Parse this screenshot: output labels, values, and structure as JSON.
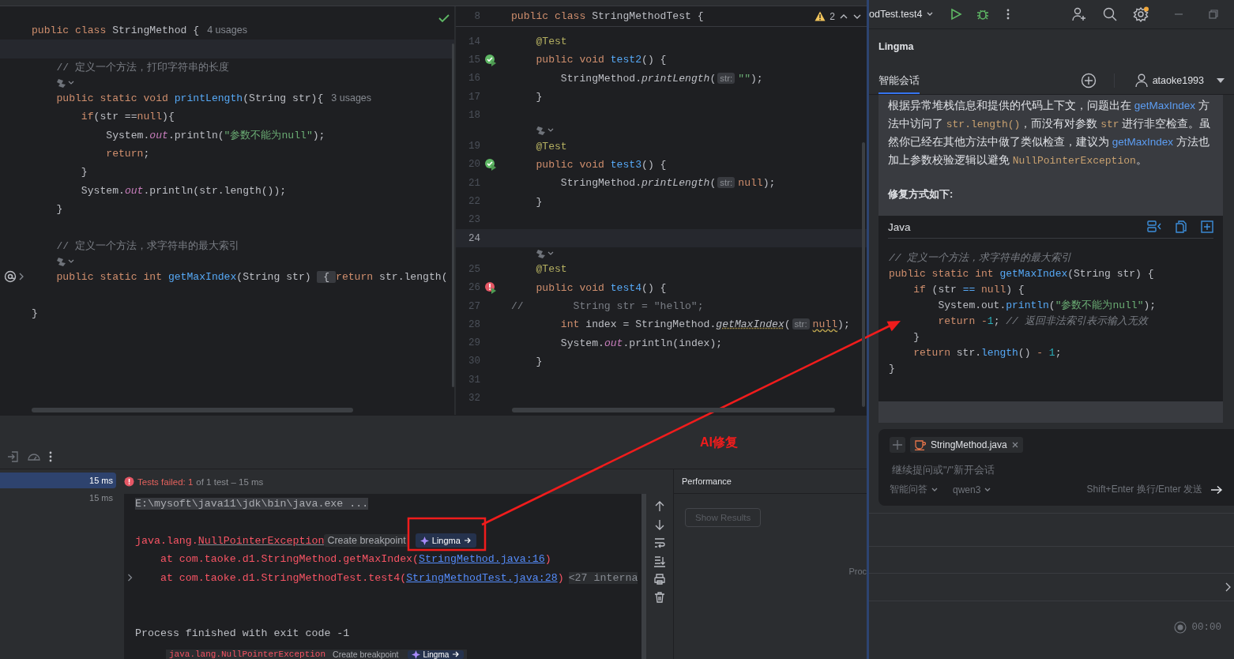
{
  "editors": [
    {
      "lines": [
        {
          "kind": "code",
          "current": false,
          "tokens": [
            {
              "kind": "keyword",
              "text": "public class "
            },
            {
              "kind": "plain",
              "text": "StringMethod {"
            },
            {
              "kind": "usages",
              "text": "4 usages"
            }
          ]
        },
        {
          "kind": "code",
          "current": true
        },
        {
          "kind": "code",
          "current": false,
          "tokens": [
            {
              "kind": "comment",
              "text": "    // 定义一个方法，打印字符串的长度"
            }
          ]
        },
        {
          "kind": "lens"
        },
        {
          "kind": "code",
          "current": false,
          "tokens": [
            {
              "kind": "keyword",
              "text": "    public static void "
            },
            {
              "kind": "method",
              "text": "printLength"
            },
            {
              "kind": "plain",
              "text": "(String str){"
            },
            {
              "kind": "usages",
              "text": "3 usages"
            }
          ]
        },
        {
          "kind": "code",
          "current": false,
          "tokens": [
            {
              "kind": "keyword",
              "text": "        if"
            },
            {
              "kind": "plain",
              "text": "(str =="
            },
            {
              "kind": "keyword",
              "text": "null"
            },
            {
              "kind": "plain",
              "text": "){"
            }
          ]
        },
        {
          "kind": "code",
          "current": false,
          "tokens": [
            {
              "kind": "plain",
              "text": "            System."
            },
            {
              "kind": "field",
              "text": "out"
            },
            {
              "kind": "plain",
              "text": ".println("
            },
            {
              "kind": "string",
              "text": "\"参数不能为null\""
            },
            {
              "kind": "plain",
              "text": ");"
            }
          ]
        },
        {
          "kind": "code",
          "current": false,
          "tokens": [
            {
              "kind": "keyword",
              "text": "            return"
            },
            {
              "kind": "plain",
              "text": ";"
            }
          ]
        },
        {
          "kind": "code",
          "current": false,
          "tokens": [
            {
              "kind": "plain",
              "text": "        }"
            }
          ]
        },
        {
          "kind": "code",
          "current": false,
          "tokens": [
            {
              "kind": "plain",
              "text": "        System."
            },
            {
              "kind": "field",
              "text": "out"
            },
            {
              "kind": "plain",
              "text": ".println(str.length());"
            }
          ]
        },
        {
          "kind": "code",
          "current": false,
          "tokens": [
            {
              "kind": "plain",
              "text": "    }"
            }
          ]
        },
        {
          "kind": "code",
          "current": false
        },
        {
          "kind": "code",
          "current": false,
          "tokens": [
            {
              "kind": "comment",
              "text": "    // 定义一个方法，求字符串的最大索引"
            }
          ]
        },
        {
          "kind": "lens"
        },
        {
          "kind": "code",
          "current": false,
          "gutter_icon": {
            "kind": "implements"
          },
          "tokens": [
            {
              "kind": "keyword",
              "text": "    public static int "
            },
            {
              "kind": "method",
              "text": "getMaxIndex"
            },
            {
              "kind": "plain",
              "text": "(String str) "
            },
            {
              "kind": "fold",
              "text": " { "
            },
            {
              "kind": "keyword",
              "text": "return"
            },
            {
              "kind": "plain",
              "text": " str.length("
            }
          ]
        },
        {
          "kind": "code",
          "current": false
        },
        {
          "kind": "code",
          "current": false,
          "tokens": [
            {
              "kind": "plain",
              "text": "}"
            }
          ]
        }
      ]
    },
    {
      "sticky_header": {
        "number": "8",
        "tokens": [
          {
            "kind": "keyword",
            "text": "public class "
          },
          {
            "kind": "plain",
            "text": "StringMethodTest {"
          }
        ]
      },
      "problems": {
        "warnings": "2"
      },
      "lines": [
        {
          "kind": "code",
          "number": "14",
          "current": false,
          "tokens": [
            {
              "kind": "annotation",
              "text": "    @Test"
            }
          ]
        },
        {
          "kind": "code",
          "number": "15",
          "current": false,
          "gutter_icon": {
            "kind": "pass"
          },
          "tokens": [
            {
              "kind": "keyword",
              "text": "    public void "
            },
            {
              "kind": "method",
              "text": "test2"
            },
            {
              "kind": "plain",
              "text": "() {"
            }
          ]
        },
        {
          "kind": "code",
          "number": "16",
          "current": false,
          "tokens": [
            {
              "kind": "plain",
              "text": "        StringMethod."
            },
            {
              "kind": "call",
              "text": "printLength"
            },
            {
              "kind": "plain",
              "text": "("
            },
            {
              "kind": "hint",
              "text": "str:"
            },
            {
              "kind": "string",
              "text": "\"\""
            },
            {
              "kind": "plain",
              "text": ");"
            }
          ]
        },
        {
          "kind": "code",
          "number": "17",
          "current": false,
          "tokens": [
            {
              "kind": "plain",
              "text": "    }"
            }
          ]
        },
        {
          "kind": "code",
          "number": "18",
          "current": false
        },
        {
          "kind": "lens"
        },
        {
          "kind": "code",
          "number": "19",
          "current": false,
          "tokens": [
            {
              "kind": "annotation",
              "text": "    @Test"
            }
          ]
        },
        {
          "kind": "code",
          "number": "20",
          "current": false,
          "gutter_icon": {
            "kind": "pass"
          },
          "tokens": [
            {
              "kind": "keyword",
              "text": "    public void "
            },
            {
              "kind": "method",
              "text": "test3"
            },
            {
              "kind": "plain",
              "text": "() {"
            }
          ]
        },
        {
          "kind": "code",
          "number": "21",
          "current": false,
          "tokens": [
            {
              "kind": "plain",
              "text": "        StringMethod."
            },
            {
              "kind": "call",
              "text": "printLength"
            },
            {
              "kind": "plain",
              "text": "("
            },
            {
              "kind": "hint",
              "text": "str:"
            },
            {
              "kind": "keyword",
              "text": "null"
            },
            {
              "kind": "plain",
              "text": ");"
            }
          ]
        },
        {
          "kind": "code",
          "number": "22",
          "current": false,
          "tokens": [
            {
              "kind": "plain",
              "text": "    }"
            }
          ]
        },
        {
          "kind": "code",
          "number": "23",
          "current": false
        },
        {
          "kind": "code",
          "number": "24",
          "current": true
        },
        {
          "kind": "lens"
        },
        {
          "kind": "code",
          "number": "25",
          "current": false,
          "tokens": [
            {
              "kind": "annotation",
              "text": "    @Test"
            }
          ]
        },
        {
          "kind": "code",
          "number": "26",
          "current": false,
          "gutter_icon": {
            "kind": "fail"
          },
          "tokens": [
            {
              "kind": "keyword",
              "text": "    public void "
            },
            {
              "kind": "method",
              "text": "test4"
            },
            {
              "kind": "plain",
              "text": "() {"
            }
          ]
        },
        {
          "kind": "code",
          "number": "27",
          "current": false,
          "tokens": [
            {
              "kind": "comment",
              "text": "//        String str = \"hello\";"
            }
          ]
        },
        {
          "kind": "code",
          "number": "28",
          "current": false,
          "tokens": [
            {
              "kind": "keyword",
              "text": "        int"
            },
            {
              "kind": "plain",
              "text": " index = StringMethod."
            },
            {
              "kind": "warn-call",
              "text": "getMaxIndex"
            },
            {
              "kind": "plain",
              "text": "("
            },
            {
              "kind": "hint",
              "text": "str:"
            },
            {
              "kind": "warn-keyword",
              "text": "null"
            },
            {
              "kind": "plain",
              "text": ");"
            }
          ]
        },
        {
          "kind": "code",
          "number": "29",
          "current": false,
          "tokens": [
            {
              "kind": "plain",
              "text": "        System."
            },
            {
              "kind": "field",
              "text": "out"
            },
            {
              "kind": "plain",
              "text": ".println(index);"
            }
          ]
        },
        {
          "kind": "code",
          "number": "30",
          "current": false,
          "tokens": [
            {
              "kind": "plain",
              "text": "    }"
            }
          ]
        },
        {
          "kind": "code",
          "number": "31",
          "current": false
        },
        {
          "kind": "code",
          "number": "32",
          "current": false
        }
      ]
    }
  ],
  "run_panel": {
    "test_tree": [
      {
        "duration": "15 ms",
        "selected": true
      },
      {
        "duration": "15 ms",
        "selected": false
      }
    ],
    "status": {
      "failed": "Tests failed: 1",
      "summary": "of 1 test – 15 ms"
    },
    "console": [
      {
        "kind": "text",
        "segments": [
          {
            "kind": "command",
            "text": "E:\\mysoft\\java11\\jdk\\bin\\java.exe ..."
          }
        ]
      },
      {
        "kind": "blank"
      },
      {
        "kind": "text",
        "segments": [
          {
            "kind": "error",
            "text": "java.lang."
          },
          {
            "kind": "error-link",
            "text": "NullPointerException"
          },
          {
            "kind": "chip",
            "text": "Create breakpoint"
          },
          {
            "kind": "ai-chip",
            "text": "Lingma"
          }
        ]
      },
      {
        "kind": "text",
        "segments": [
          {
            "kind": "error",
            "text": "    at com.taoke.d1.StringMethod.getMaxIndex("
          },
          {
            "kind": "link",
            "text": "StringMethod.java:16"
          },
          {
            "kind": "error",
            "text": ")"
          }
        ]
      },
      {
        "kind": "trace-group",
        "expanded": false,
        "segments": [
          {
            "kind": "error",
            "text": "    at com.taoke.d1.StringMethodTest.test4("
          },
          {
            "kind": "link",
            "text": "StringMethodTest.java:28"
          },
          {
            "kind": "error",
            "text": ")"
          },
          {
            "kind": "folded",
            "text": "<27 interna"
          }
        ]
      },
      {
        "kind": "blank"
      },
      {
        "kind": "blank"
      },
      {
        "kind": "text",
        "segments": [
          {
            "kind": "output",
            "text": "Process finished with exit code -1"
          }
        ]
      }
    ],
    "drag_preview": [
      {
        "kind": "error",
        "text": "java.lang.NullPointerException"
      },
      {
        "kind": "chip",
        "text": "Create breakpoint"
      },
      {
        "kind": "ai-chip",
        "text": "Lingma"
      }
    ],
    "performance": {
      "title": "Performance",
      "button": {
        "label": "Show Results",
        "disabled": true
      },
      "cut_text": "Proc"
    }
  },
  "assistant": {
    "run_config": "odTest.test4",
    "title": "Lingma",
    "tabs": [
      {
        "label": "智能会话",
        "selected": true
      }
    ],
    "user": "ataoke1993",
    "message": {
      "paragraph": [
        {
          "kind": "text",
          "text": "根据异常堆栈信息和提供的代码上下文，问题出在 "
        },
        {
          "kind": "link",
          "text": "getMaxIndex"
        },
        {
          "kind": "text",
          "text": " 方法中访问了 "
        },
        {
          "kind": "code",
          "text": "str.length()"
        },
        {
          "kind": "text",
          "text": "，而没有对参数 "
        },
        {
          "kind": "code",
          "text": "str"
        },
        {
          "kind": "text",
          "text": " 进行非空检查。虽然你已经在其他方法中做了类似检查，建议为 "
        },
        {
          "kind": "link",
          "text": "getMaxIndex"
        },
        {
          "kind": "text",
          "text": " 方法也加上参数校验逻辑以避免 "
        },
        {
          "kind": "code",
          "text": "NullPointerException"
        },
        {
          "kind": "text",
          "text": "。"
        }
      ],
      "heading": "修复方式如下:",
      "code_block": {
        "language": "Java",
        "lines": [
          [
            {
              "kind": "comment",
              "text": "// 定义一个方法，求字符串的最大索引"
            }
          ],
          [
            {
              "kind": "keyword",
              "text": "public static int "
            },
            {
              "kind": "method",
              "text": "getMaxIndex"
            },
            {
              "kind": "plain",
              "text": "(String str) {"
            }
          ],
          [
            {
              "kind": "keyword",
              "text": "    if"
            },
            {
              "kind": "plain",
              "text": " (str "
            },
            {
              "kind": "method",
              "text": "=="
            },
            {
              "kind": "keyword",
              "text": " null"
            },
            {
              "kind": "plain",
              "text": ") {"
            }
          ],
          [
            {
              "kind": "plain",
              "text": "        System.out."
            },
            {
              "kind": "method",
              "text": "println"
            },
            {
              "kind": "plain",
              "text": "("
            },
            {
              "kind": "string",
              "text": "\"参数不能为null\""
            },
            {
              "kind": "plain",
              "text": ");"
            }
          ],
          [
            {
              "kind": "keyword",
              "text": "        return "
            },
            {
              "kind": "keyword",
              "text": "-"
            },
            {
              "kind": "number",
              "text": "1"
            },
            {
              "kind": "plain",
              "text": "; "
            },
            {
              "kind": "comment",
              "text": "// 返回非法索引表示输入无效"
            }
          ],
          [
            {
              "kind": "plain",
              "text": "    }"
            }
          ],
          [
            {
              "kind": "keyword",
              "text": "    return"
            },
            {
              "kind": "plain",
              "text": " str."
            },
            {
              "kind": "method",
              "text": "length"
            },
            {
              "kind": "plain",
              "text": "() "
            },
            {
              "kind": "keyword",
              "text": "- "
            },
            {
              "kind": "number",
              "text": "1"
            },
            {
              "kind": "plain",
              "text": ";"
            }
          ],
          [
            {
              "kind": "plain",
              "text": "}"
            }
          ]
        ]
      }
    },
    "input": {
      "context_files": [
        {
          "name": "StringMethod.java"
        }
      ],
      "placeholder": "继续提问或\"/\"新开会话",
      "mode": "智能问答",
      "model": "qwen3",
      "hint": "Shift+Enter 换行/Enter 发送"
    },
    "timer": "00:00"
  },
  "annotation": {
    "label": "AI修复"
  }
}
